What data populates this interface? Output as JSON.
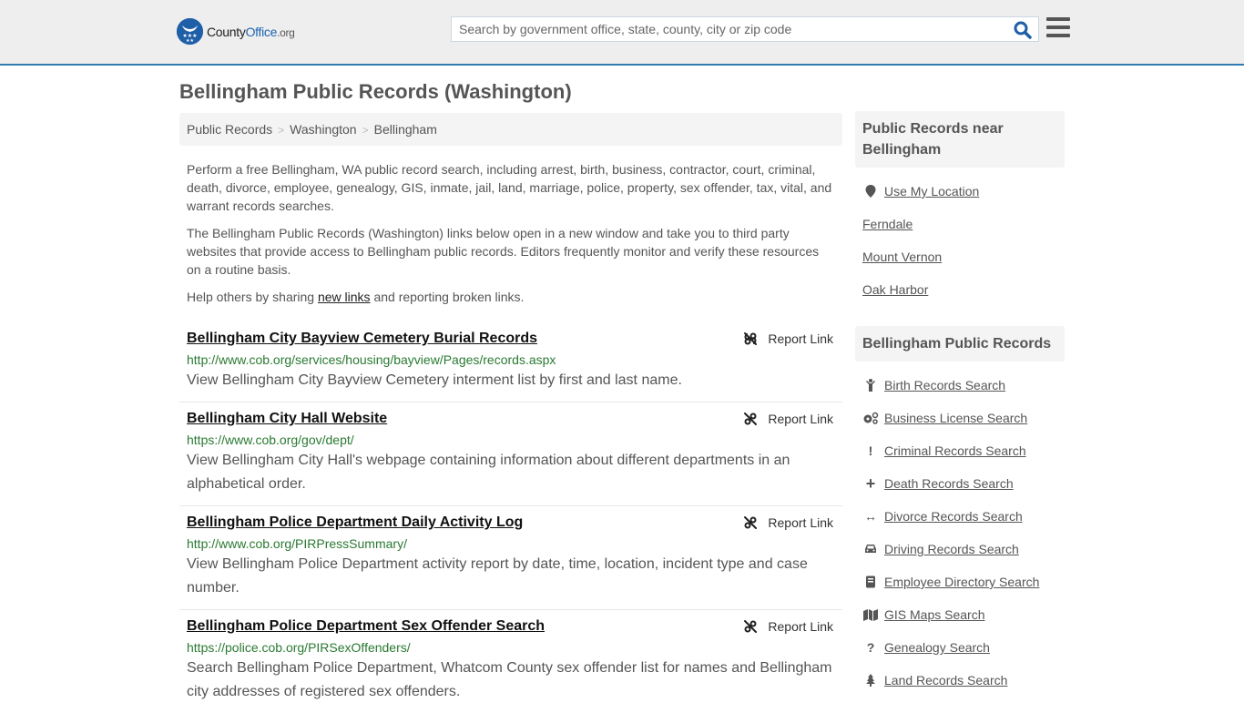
{
  "header": {
    "logo": {
      "part1": "County",
      "part2": "Office",
      "part3": ".org"
    },
    "search": {
      "placeholder": "Search by government office, state, county, city or zip code",
      "value": ""
    },
    "icons": {
      "search": "search-icon",
      "menu": "hamburger-menu-icon"
    },
    "colors": {
      "brand_blue": "#1f5fa8",
      "header_border": "#2f7ab0",
      "url_green": "#2a7a32"
    }
  },
  "page": {
    "title": "Bellingham Public Records (Washington)",
    "breadcrumb": [
      {
        "label": "Public Records"
      },
      {
        "label": "Washington"
      },
      {
        "label": "Bellingham"
      }
    ],
    "breadcrumb_separator": ">",
    "intro": {
      "p1": "Perform a free Bellingham, WA public record search, including arrest, birth, business, contractor, court, criminal, death, divorce, employee, genealogy, GIS, inmate, jail, land, marriage, police, property, sex offender, tax, vital, and warrant records searches.",
      "p2": "The Bellingham Public Records (Washington) links below open in a new window and take you to third party websites that provide access to Bellingham public records. Editors frequently monitor and verify these resources on a routine basis.",
      "p3_before": "Help others by sharing ",
      "p3_link": "new links",
      "p3_after": " and reporting broken links."
    },
    "report_label": "Report Link",
    "records": [
      {
        "title": "Bellingham City Bayview Cemetery Burial Records",
        "url": "http://www.cob.org/services/housing/bayview/Pages/records.aspx",
        "description": "View Bellingham City Bayview Cemetery interment list by first and last name."
      },
      {
        "title": "Bellingham City Hall Website",
        "url": "https://www.cob.org/gov/dept/",
        "description": "View Bellingham City Hall's webpage containing information about different departments in an alphabetical order."
      },
      {
        "title": "Bellingham Police Department Daily Activity Log",
        "url": "http://www.cob.org/PIRPressSummary/",
        "description": "View Bellingham Police Department activity report by date, time, location, incident type and case number."
      },
      {
        "title": "Bellingham Police Department Sex Offender Search",
        "url": "https://police.cob.org/PIRSexOffenders/",
        "description": "Search Bellingham Police Department, Whatcom County sex offender list for names and Bellingham city addresses of registered sex offenders."
      }
    ]
  },
  "sidebar": {
    "near": {
      "heading": "Public Records near Bellingham",
      "use_location": "Use My Location",
      "places": [
        {
          "label": "Ferndale"
        },
        {
          "label": "Mount Vernon"
        },
        {
          "label": "Oak Harbor"
        }
      ]
    },
    "records": {
      "heading": "Bellingham Public Records",
      "items": [
        {
          "label": "Birth Records Search",
          "icon": "child-icon"
        },
        {
          "label": "Business License Search",
          "icon": "cogs-icon"
        },
        {
          "label": "Criminal Records Search",
          "icon": "exclamation-icon"
        },
        {
          "label": "Death Records Search",
          "icon": "plus-icon"
        },
        {
          "label": "Divorce Records Search",
          "icon": "arrows-horizontal-icon"
        },
        {
          "label": "Driving Records Search",
          "icon": "car-icon"
        },
        {
          "label": "Employee Directory Search",
          "icon": "book-icon"
        },
        {
          "label": "GIS Maps Search",
          "icon": "map-icon"
        },
        {
          "label": "Genealogy Search",
          "icon": "question-icon"
        },
        {
          "label": "Land Records Search",
          "icon": "tree-icon"
        }
      ]
    }
  }
}
